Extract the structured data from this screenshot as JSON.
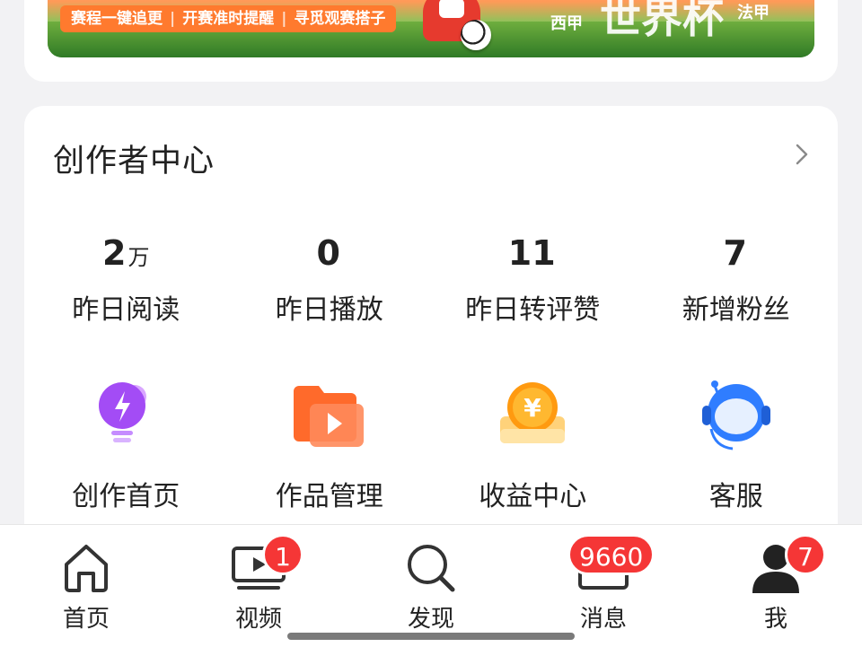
{
  "banner": {
    "slogan": [
      "赛程一键追更",
      "开赛准时提醒",
      "寻觅观赛搭子"
    ],
    "league_left": "西甲",
    "cup_text": "世界杯",
    "league_right": "法甲"
  },
  "creator": {
    "title": "创作者中心",
    "stats": [
      {
        "value": "2",
        "unit": "万",
        "label": "昨日阅读"
      },
      {
        "value": "0",
        "unit": "",
        "label": "昨日播放"
      },
      {
        "value": "11",
        "unit": "",
        "label": "昨日转评赞"
      },
      {
        "value": "7",
        "unit": "",
        "label": "新增粉丝"
      }
    ],
    "tools": [
      {
        "label": "创作首页",
        "icon": "lightning-bulb-icon"
      },
      {
        "label": "作品管理",
        "icon": "video-folder-icon"
      },
      {
        "label": "收益中心",
        "icon": "yuan-coin-icon"
      },
      {
        "label": "客服",
        "icon": "headset-robot-icon"
      }
    ]
  },
  "nav": {
    "items": [
      {
        "label": "首页",
        "icon": "home-icon",
        "badge": ""
      },
      {
        "label": "视频",
        "icon": "video-icon",
        "badge": "1"
      },
      {
        "label": "发现",
        "icon": "search-icon",
        "badge": ""
      },
      {
        "label": "消息",
        "icon": "message-icon",
        "badge": "9660"
      },
      {
        "label": "我",
        "icon": "profile-icon",
        "badge": "7"
      }
    ]
  },
  "colors": {
    "badge": "#f53636",
    "background": "#f2f2f4",
    "banner_orange": "#ff7a2e"
  }
}
